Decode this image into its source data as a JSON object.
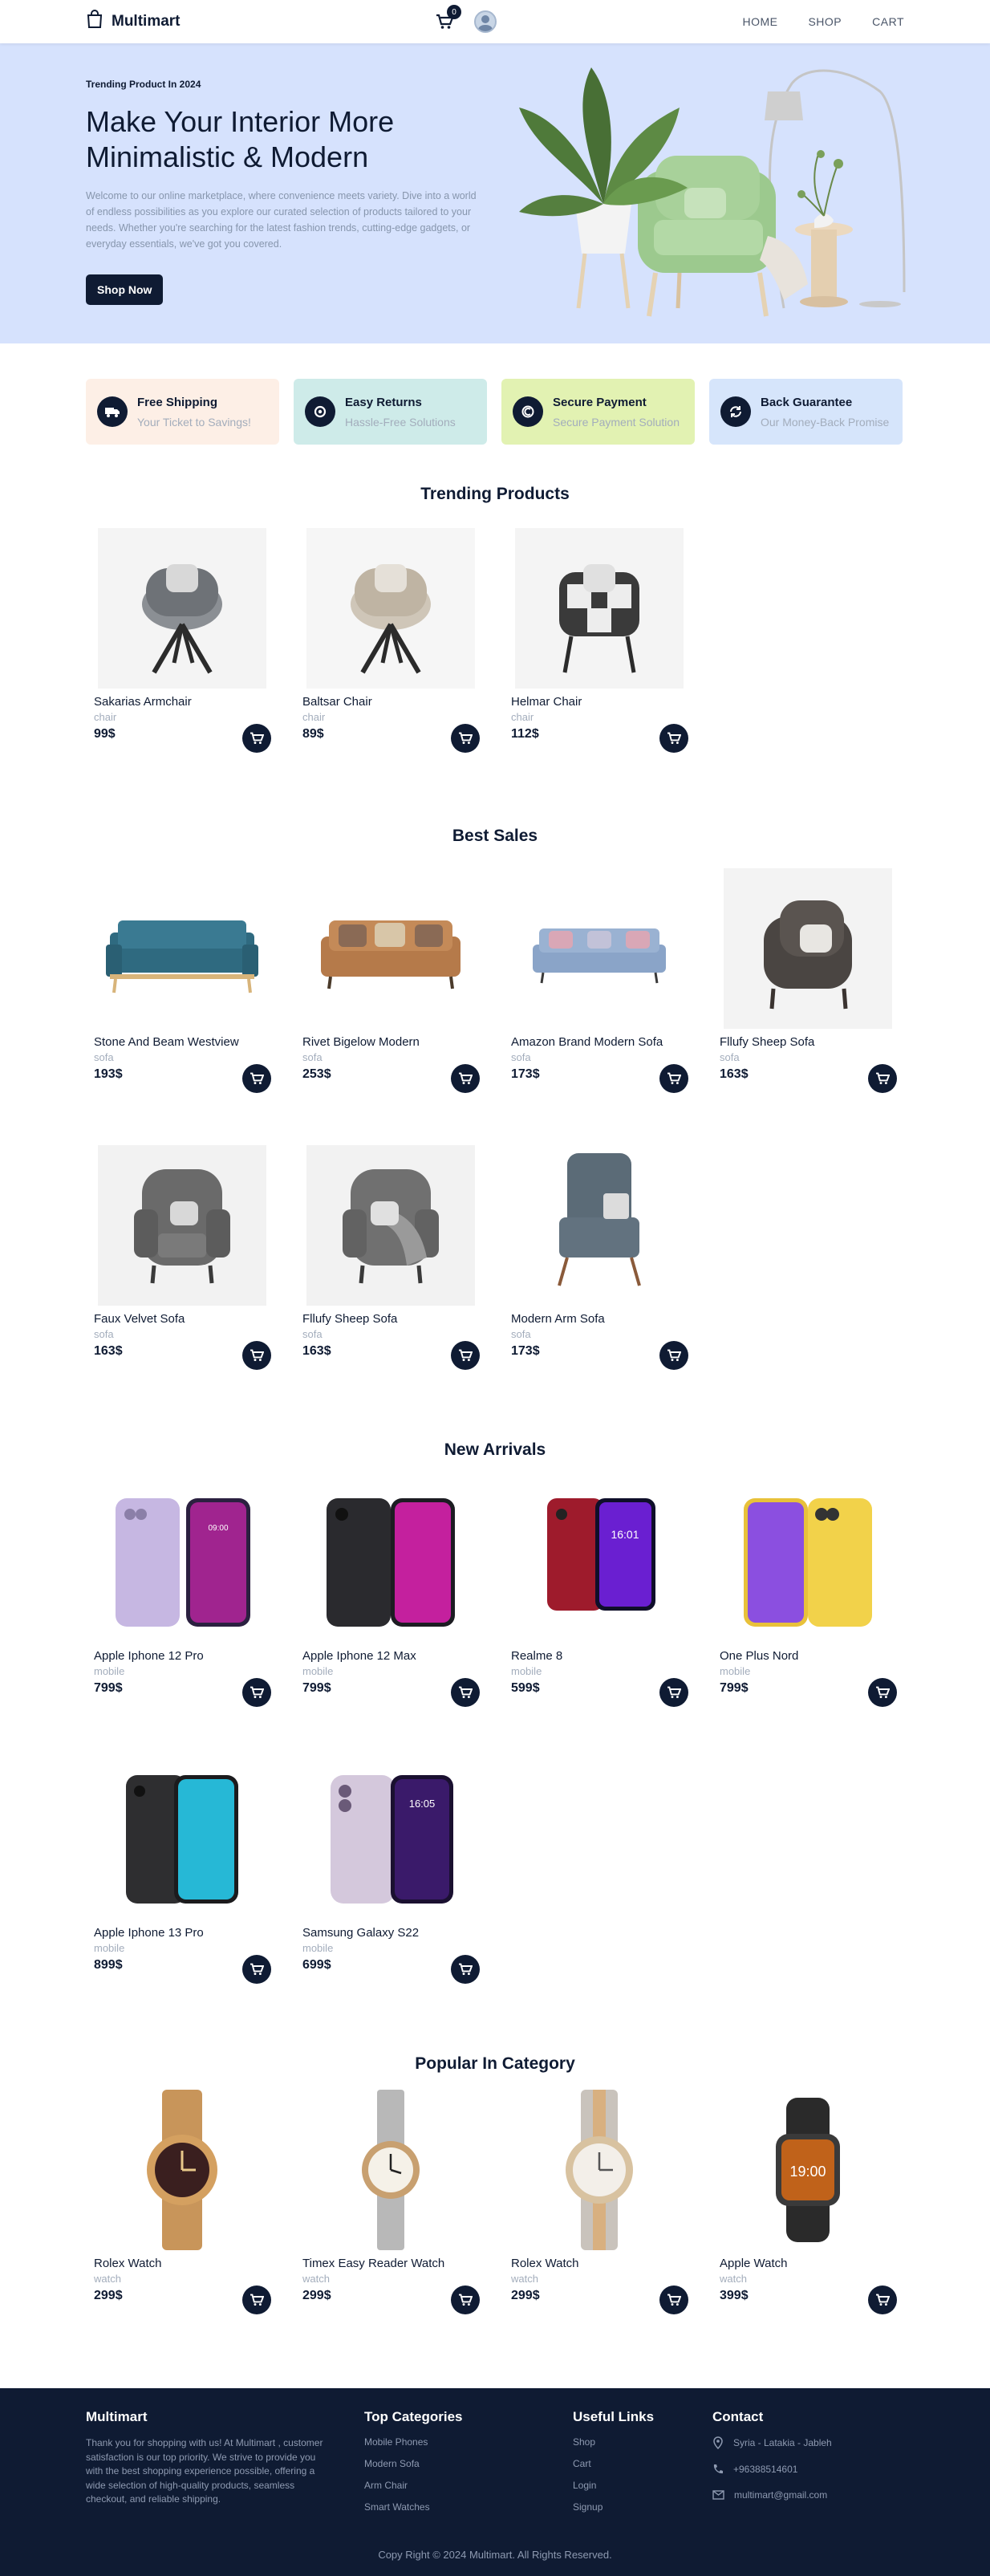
{
  "navbar": {
    "brand": "Multimart",
    "cart_count": "0",
    "links": [
      "HOME",
      "SHOP",
      "CART"
    ]
  },
  "hero": {
    "kicker": "Trending Product In 2024",
    "title_line1": "Make Your Interior More",
    "title_line2": "Minimalistic & Modern",
    "description": "Welcome to our online marketplace, where convenience meets variety. Dive into a world of endless possibilities as you explore our curated selection of products tailored to your needs. Whether you're searching for the latest fashion trends, cutting-edge gadgets, or everyday essentials, we've got you covered.",
    "button": "Shop Now"
  },
  "services": [
    {
      "title": "Free Shipping",
      "subtitle": "Your Ticket to Savings!",
      "color": "#fdefe6",
      "icon": "truck-icon"
    },
    {
      "title": "Easy Returns",
      "subtitle": "Hassle-Free Solutions",
      "color": "#ceebe9",
      "icon": "refresh-icon"
    },
    {
      "title": "Secure Payment",
      "subtitle": "Secure Payment Solution",
      "color": "#e2f2b2",
      "icon": "secure-icon"
    },
    {
      "title": "Back Guarantee",
      "subtitle": "Our Money-Back Promise",
      "color": "#d6e5fb",
      "icon": "exchange-icon"
    }
  ],
  "trending": {
    "title": "Trending Products",
    "products": [
      {
        "name": "Sakarias Armchair",
        "category": "chair",
        "price": "99$"
      },
      {
        "name": "Baltsar Chair",
        "category": "chair",
        "price": "89$"
      },
      {
        "name": "Helmar Chair",
        "category": "chair",
        "price": "112$"
      }
    ]
  },
  "best_sales": {
    "title": "Best Sales",
    "products": [
      {
        "name": "Stone And Beam Westview",
        "category": "sofa",
        "price": "193$"
      },
      {
        "name": "Rivet Bigelow Modern",
        "category": "sofa",
        "price": "253$"
      },
      {
        "name": "Amazon Brand Modern Sofa",
        "category": "sofa",
        "price": "173$"
      },
      {
        "name": "Fllufy Sheep Sofa",
        "category": "sofa",
        "price": "163$"
      },
      {
        "name": "Faux Velvet Sofa",
        "category": "sofa",
        "price": "163$"
      },
      {
        "name": "Fllufy Sheep Sofa",
        "category": "sofa",
        "price": "163$"
      },
      {
        "name": "Modern Arm Sofa",
        "category": "sofa",
        "price": "173$"
      }
    ]
  },
  "new_arrivals": {
    "title": "New Arrivals",
    "products": [
      {
        "name": "Apple Iphone 12 Pro",
        "category": "mobile",
        "price": "799$"
      },
      {
        "name": "Apple Iphone 12 Max",
        "category": "mobile",
        "price": "799$"
      },
      {
        "name": "Realme 8",
        "category": "mobile",
        "price": "599$"
      },
      {
        "name": "One Plus Nord",
        "category": "mobile",
        "price": "799$"
      },
      {
        "name": "Apple Iphone 13 Pro",
        "category": "mobile",
        "price": "899$"
      },
      {
        "name": "Samsung Galaxy S22",
        "category": "mobile",
        "price": "699$"
      }
    ]
  },
  "popular": {
    "title": "Popular In Category",
    "products": [
      {
        "name": "Rolex Watch",
        "category": "watch",
        "price": "299$"
      },
      {
        "name": "Timex Easy Reader Watch",
        "category": "watch",
        "price": "299$"
      },
      {
        "name": "Rolex Watch",
        "category": "watch",
        "price": "299$"
      },
      {
        "name": "Apple Watch",
        "category": "watch",
        "price": "399$"
      }
    ]
  },
  "footer": {
    "brand": "Multimart",
    "description": "Thank you for shopping with us! At Multimart , customer satisfaction is our top priority. We strive to provide you with the best shopping experience possible, offering a wide selection of high-quality products, seamless checkout, and reliable shipping.",
    "categories_title": "Top Categories",
    "categories": [
      "Mobile Phones",
      "Modern Sofa",
      "Arm Chair",
      "Smart Watches"
    ],
    "links_title": "Useful Links",
    "links": [
      "Shop",
      "Cart",
      "Login",
      "Signup"
    ],
    "contact_title": "Contact",
    "address": "Syria - Latakia - Jableh",
    "phone": "+96388514601",
    "email": "multimart@gmail.com",
    "copyright": "Copy Right © 2024 Multimart. All Rights Reserved."
  }
}
